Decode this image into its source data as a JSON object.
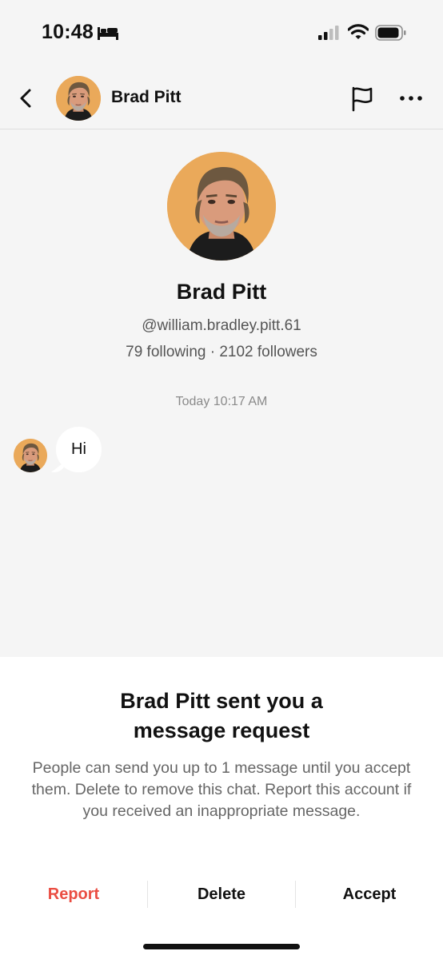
{
  "status_bar": {
    "time": "10:48"
  },
  "header": {
    "name": "Brad Pitt"
  },
  "profile": {
    "name": "Brad Pitt",
    "handle": "@william.bradley.pitt.61",
    "stats": "79 following · 2102 followers"
  },
  "chat": {
    "timestamp": "Today 10:17 AM",
    "messages": [
      {
        "text": "Hi"
      }
    ]
  },
  "request_panel": {
    "title": "Brad Pitt sent you a message request",
    "body": "People can send you up to 1 message until you accept them. Delete to remove this chat. Report this account if you received an inappropriate message.",
    "actions": {
      "report": "Report",
      "delete": "Delete",
      "accept": "Accept"
    }
  },
  "colors": {
    "background": "#f5f5f5",
    "report_red": "#ea4d42",
    "text": "#111111",
    "muted": "#555555"
  },
  "icons": [
    "bed-icon",
    "signal-icon",
    "wifi-icon",
    "battery-icon",
    "back-arrow-icon",
    "flag-icon",
    "more-icon"
  ]
}
